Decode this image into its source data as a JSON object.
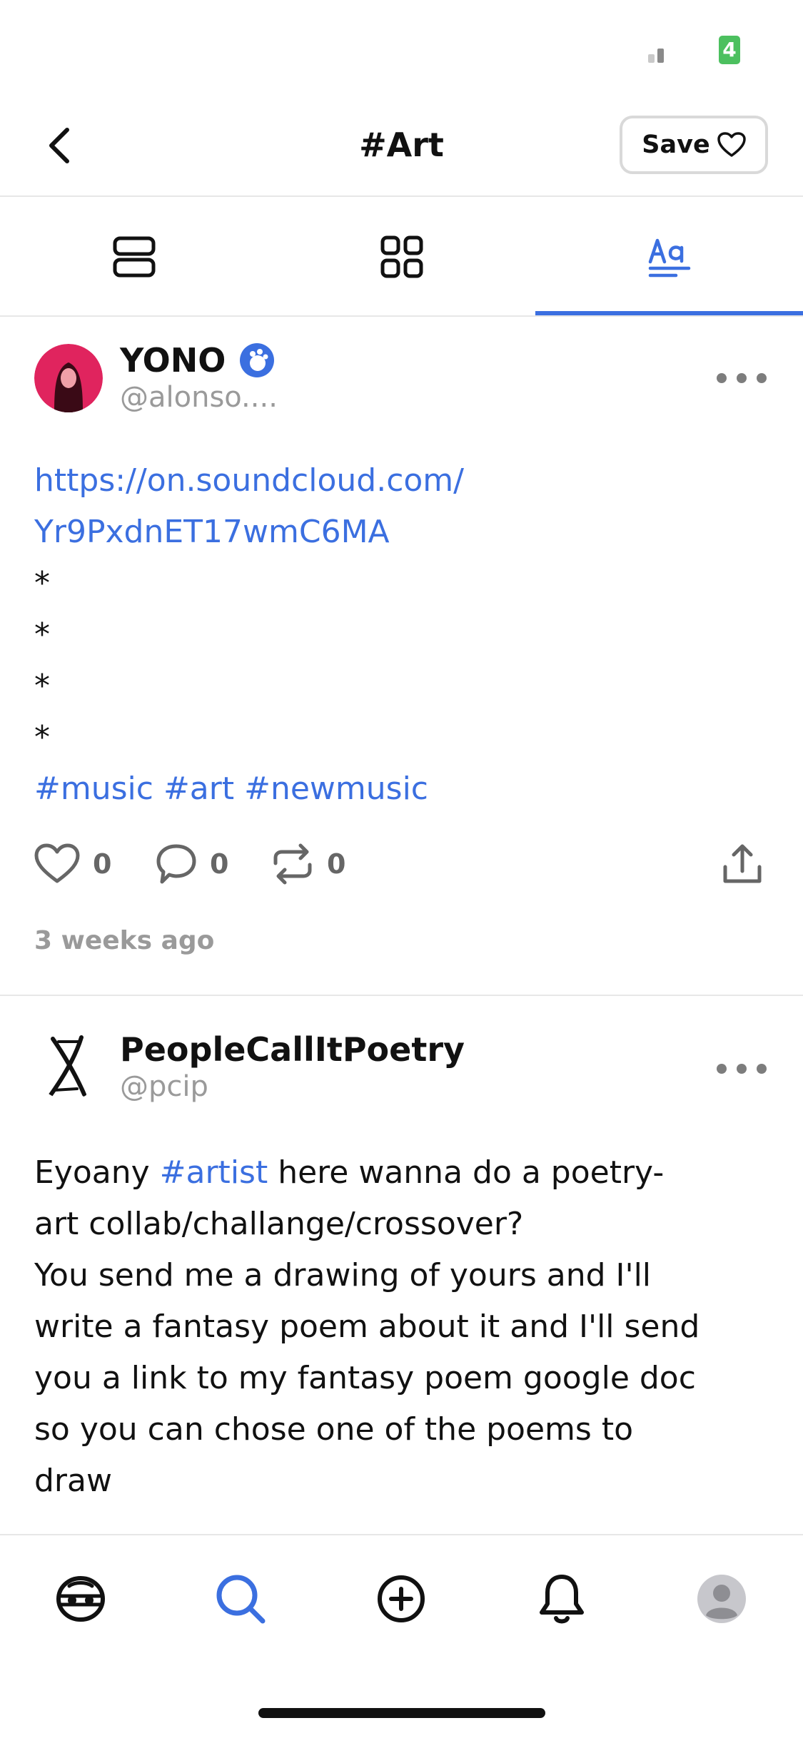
{
  "status_bar": {
    "battery_label": "4"
  },
  "header": {
    "title": "#Art",
    "save_label": "Save"
  },
  "tabs": [
    {
      "icon": "list-view-icon",
      "active": false
    },
    {
      "icon": "grid-view-icon",
      "active": false
    },
    {
      "icon": "text-view-icon",
      "active": true
    }
  ],
  "colors": {
    "accent": "#3b6fe0",
    "muted": "#9a9a9a",
    "battery": "#4cc05f"
  },
  "posts": [
    {
      "display_name": "YONO",
      "handle": "@alonso....",
      "verified": true,
      "link_lines": [
        "https://on.soundcloud.com/",
        "Yr9PxdnET17wmC6MA"
      ],
      "bullets": [
        "*",
        "*",
        "*",
        "*"
      ],
      "hashtags": "#music #art #newmusic",
      "likes": "0",
      "comments": "0",
      "reposts": "0",
      "time_ago": "3 weeks ago"
    },
    {
      "display_name": "PeopleCallItPoetry",
      "handle": "@pcip",
      "intro_before": "Eyoany ",
      "intro_tag": "#artist",
      "intro_after": " here wanna do a poetry-",
      "lines": [
        "art collab/challange/crossover?",
        "You send me a drawing of yours  and I'll",
        "write a fantasy poem about it and I'll send",
        "you a link to my fantasy poem google doc",
        "so you can chose one of the poems to",
        "draw"
      ]
    }
  ],
  "bottom_nav": [
    "home-icon",
    "search-icon",
    "create-post-icon",
    "notifications-icon",
    "profile-icon"
  ]
}
